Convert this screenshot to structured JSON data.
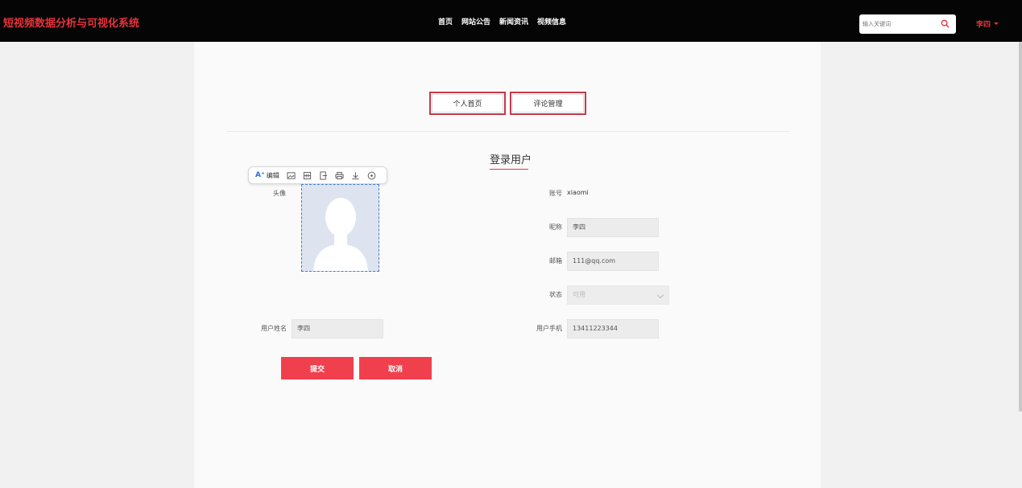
{
  "header": {
    "brand": "短视频数据分析与可视化系统",
    "nav": [
      "首页",
      "网站公告",
      "新闻资讯",
      "视频信息"
    ],
    "search_placeholder": "输入关键词",
    "user_name": "李四"
  },
  "tabs": [
    "个人首页",
    "评论管理"
  ],
  "section_title": "登录用户",
  "toolbar": {
    "edit_label": "编辑"
  },
  "form": {
    "avatar_label": "头像",
    "account_label": "账号",
    "account_value": "xiaomi",
    "nickname_label": "昵称",
    "nickname_value": "李四",
    "email_label": "邮箱",
    "email_value": "111@qq.com",
    "status_label": "状态",
    "status_value": "可用",
    "realname_label": "用户姓名",
    "realname_value": "李四",
    "phone_label": "用户手机",
    "phone_value": "13411223344"
  },
  "buttons": {
    "submit": "提交",
    "cancel": "取消"
  },
  "colors": {
    "brand": "#e8323a",
    "button": "#f0404d",
    "header_bg": "#050505"
  }
}
